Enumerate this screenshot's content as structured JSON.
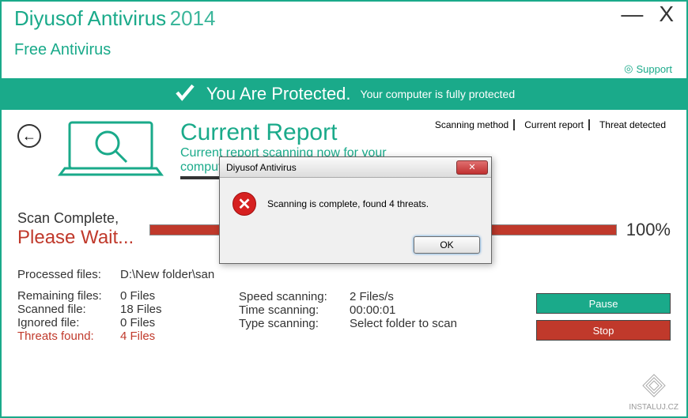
{
  "header": {
    "app_name": "Diyusof Antivirus",
    "year": "2014",
    "subtitle": "Free Antivirus",
    "support_label": "Support"
  },
  "status_banner": {
    "main": "You Are Protected.",
    "sub": "Your computer is fully protected"
  },
  "tabs": {
    "scanning_method": "Scanning method",
    "current_report": "Current report",
    "threat_detected": "Threat detected"
  },
  "report": {
    "title": "Current Report",
    "subtitle": "Current report scanning now for your computer."
  },
  "scan_status": {
    "line1": "Scan Complete,",
    "line2": "Please Wait...",
    "percent": "100%"
  },
  "stats": {
    "processed_label": "Processed files:",
    "processed_value": "D:\\New folder\\san",
    "remaining_label": "Remaining files:",
    "remaining_value": "0 Files",
    "scanned_label": "Scanned file:",
    "scanned_value": "18 Files",
    "ignored_label": "Ignored file:",
    "ignored_value": "0 Files",
    "threats_label": "Threats found:",
    "threats_value": "4 Files",
    "speed_label": "Speed scanning:",
    "speed_value": "2 Files/s",
    "time_label": "Time scanning:",
    "time_value": "00:00:01",
    "type_label": "Type scanning:",
    "type_value": "Select folder to scan"
  },
  "buttons": {
    "pause": "Pause",
    "stop": "Stop"
  },
  "modal": {
    "title": "Diyusof Antivirus",
    "message": "Scanning is complete, found 4 threats.",
    "ok": "OK"
  },
  "watermark": "INSTALUJ.CZ"
}
